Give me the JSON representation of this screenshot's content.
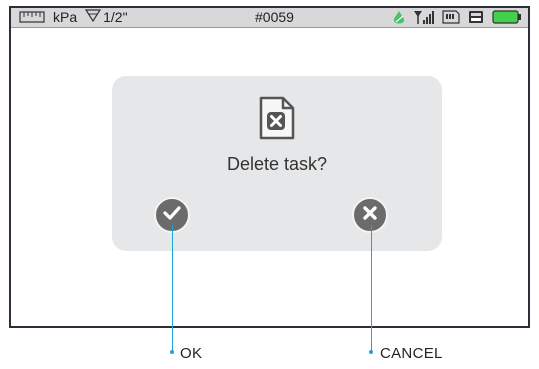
{
  "status_bar": {
    "unit": "kPa",
    "pipe_size": "1/2\"",
    "task_id": "#0059",
    "icons": [
      "ruler-icon",
      "funnel-icon",
      "gas-icon",
      "signal-icon",
      "sd-card-icon",
      "usb-drive-icon",
      "battery-icon"
    ]
  },
  "dialog": {
    "icon": "delete-file-icon",
    "message": "Delete task?",
    "ok_icon": "check-icon",
    "cancel_icon": "x-icon"
  },
  "callouts": {
    "ok_label": "OK",
    "cancel_label": "CANCEL"
  },
  "colors": {
    "status_bar_bg": "#d8d8d8",
    "dialog_bg": "#e6e7e8",
    "button_bg": "#6b6b6b",
    "callout": "#1aa7d8",
    "battery": "#43d04a",
    "gas": "#4cc06a"
  }
}
